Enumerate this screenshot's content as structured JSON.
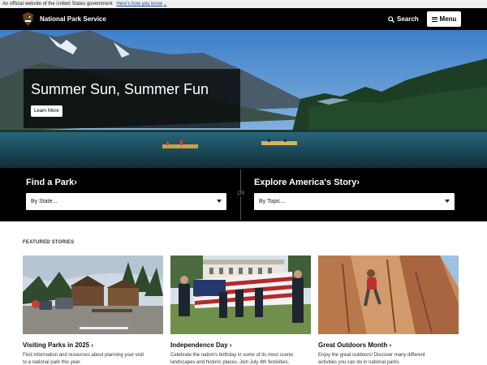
{
  "gov_banner": {
    "text": "An official website of the United States government",
    "link": "Here's how you know",
    "caret": "⌄"
  },
  "header": {
    "brand": "National Park Service",
    "search_label": "Search",
    "menu_label": "Menu"
  },
  "hero": {
    "title": "Summer Sun, Summer Fun",
    "button": "Learn More"
  },
  "finder": {
    "find_title": "Find a Park",
    "find_select": "By State...",
    "or": "OR",
    "explore_title": "Explore America's Story",
    "explore_select": "By Topic...",
    "chevron": "›"
  },
  "featured": {
    "heading": "FEATURED STORIES",
    "cards": [
      {
        "title": "Visiting Parks in 2025",
        "desc_line1": "Find information and resources about planning your visit",
        "desc_line2": "to a national park this year."
      },
      {
        "title": "Independence Day",
        "desc_line1": "Celebrate the nation's birthday in some of its most scenic",
        "desc_line2": "landscapes and historic places. Join July 4th festivities."
      },
      {
        "title": "Great Outdoors Month",
        "desc_line1": "Enjoy the great outdoors! Discover many different",
        "desc_line2": "activities you can do in national parks."
      }
    ]
  },
  "icons": {
    "logo": "arrowhead-logo-icon",
    "search": "search-icon",
    "menu": "hamburger-menu-icon",
    "select": "chevron-down-icon"
  },
  "colors": {
    "header_bg": "#000000",
    "banner_bg": "#f0f0f0",
    "link": "#1a4fa3"
  }
}
